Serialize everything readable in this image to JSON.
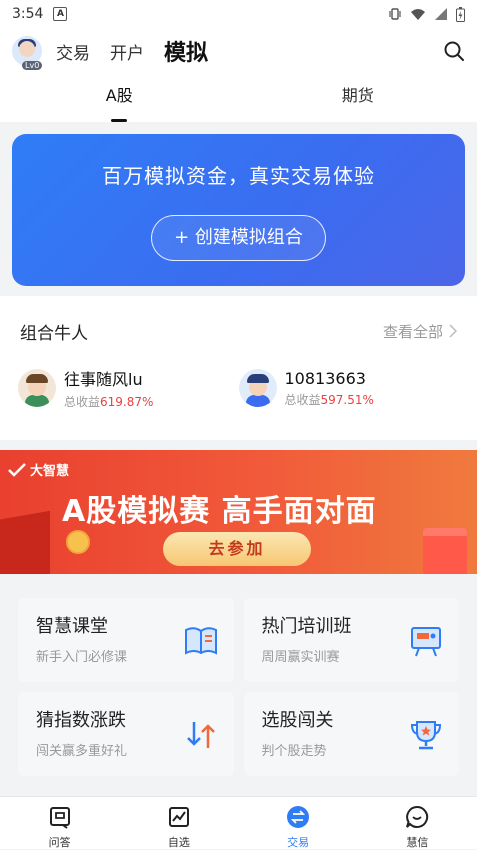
{
  "status_bar": {
    "time": "3:54",
    "notif_letter": "A"
  },
  "header": {
    "avatar_level": "Lv0",
    "tabs": [
      "交易",
      "开户",
      "模拟"
    ]
  },
  "sub_tabs": [
    "A股",
    "期货"
  ],
  "hero": {
    "slogan": "百万模拟资金，真实交易体验",
    "create_button": "+ 创建模拟组合"
  },
  "traders_section": {
    "title": "组合牛人",
    "more": "查看全部",
    "traders": [
      {
        "name": "往事随风lu",
        "label": "总收益",
        "pct": "619.87%"
      },
      {
        "name": "10813663",
        "label": "总收益",
        "pct": "597.51%"
      }
    ]
  },
  "banner": {
    "logo": "大智慧",
    "headline": "A股模拟赛  高手面对面",
    "button": "去参加"
  },
  "cards": [
    {
      "title": "智慧课堂",
      "subtitle": "新手入门必修课",
      "icon": "book-icon"
    },
    {
      "title": "热门培训班",
      "subtitle": "周周赢实训赛",
      "icon": "presentation-board-icon"
    },
    {
      "title": "猜指数涨跌",
      "subtitle": "闯关赢多重好礼",
      "icon": "up-down-arrows-icon"
    },
    {
      "title": "选股闯关",
      "subtitle": "判个股走势",
      "icon": "trophy-icon"
    }
  ],
  "tab_bar": [
    {
      "label": "问答",
      "icon": "qa-icon"
    },
    {
      "label": "自选",
      "icon": "chart-icon"
    },
    {
      "label": "交易",
      "icon": "trade-icon"
    },
    {
      "label": "慧信",
      "icon": "chat-icon"
    }
  ],
  "colors": {
    "accent": "#2f7df6",
    "gain": "#e84141",
    "banner": "#ef4b32"
  }
}
